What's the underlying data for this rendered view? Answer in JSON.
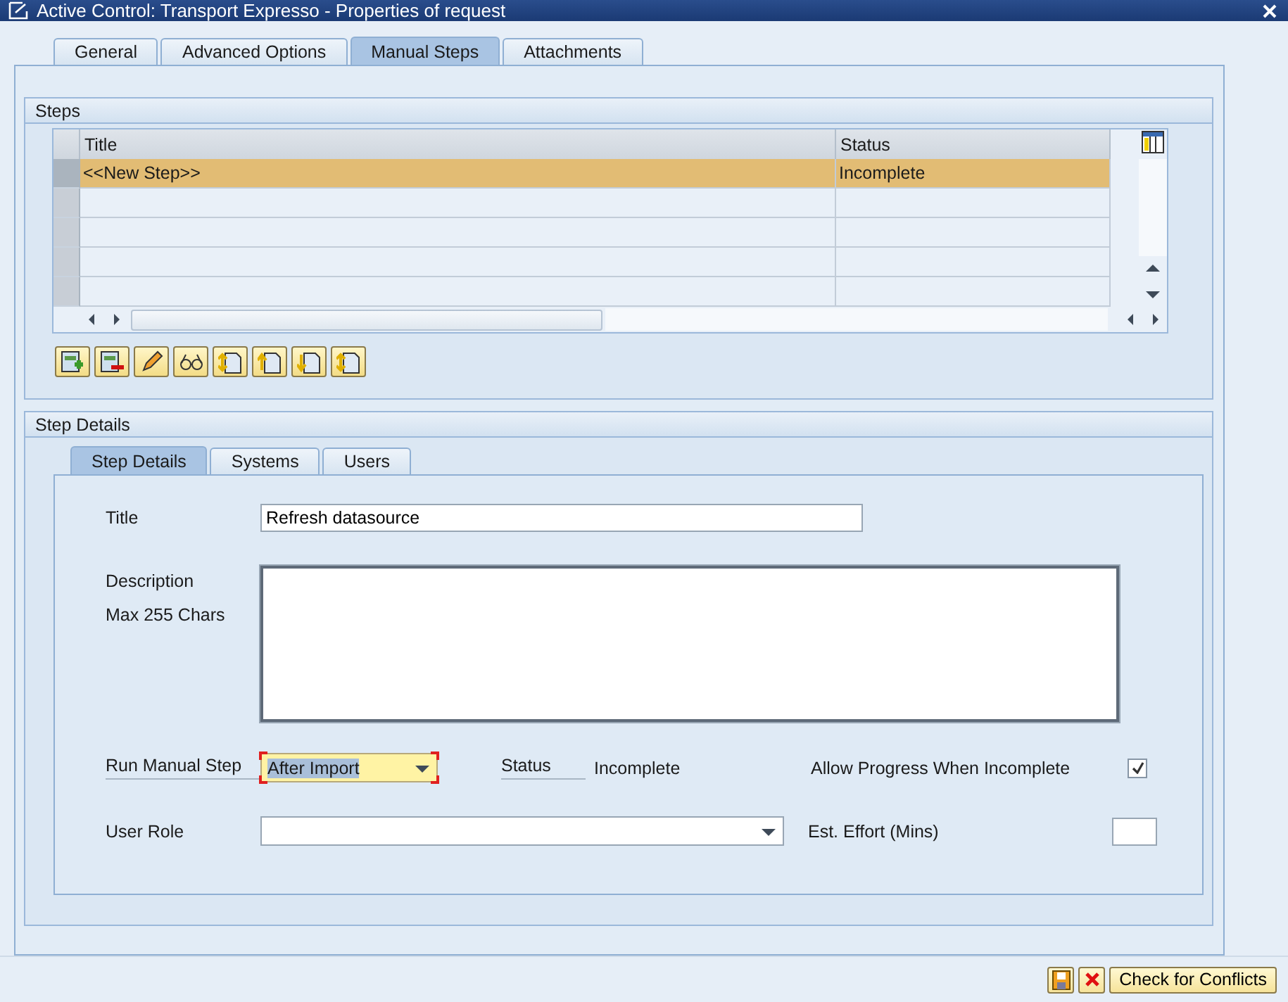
{
  "window": {
    "title": "Active Control: Transport Expresso - Properties of request"
  },
  "tabs": [
    {
      "label": "General",
      "selected": false
    },
    {
      "label": "Advanced Options",
      "selected": false
    },
    {
      "label": "Manual Steps",
      "selected": true
    },
    {
      "label": "Attachments",
      "selected": false
    }
  ],
  "steps": {
    "title": "Steps",
    "table": {
      "columns": [
        "Title",
        "Status"
      ],
      "rows": [
        {
          "title": "<<New Step>>",
          "status": "Incomplete",
          "selected": true
        }
      ]
    },
    "toolbar": [
      {
        "kind": "add"
      },
      {
        "kind": "delete"
      },
      {
        "kind": "edit"
      },
      {
        "kind": "display"
      },
      {
        "kind": "move-both"
      },
      {
        "kind": "move-up"
      },
      {
        "kind": "move-down"
      },
      {
        "kind": "move-both"
      }
    ]
  },
  "step_details": {
    "title": "Step Details",
    "tabs": [
      {
        "label": "Step Details",
        "selected": true
      },
      {
        "label": "Systems",
        "selected": false
      },
      {
        "label": "Users",
        "selected": false
      }
    ],
    "title_label": "Title",
    "title_value": "Refresh datasource",
    "description_label": "Description",
    "description_hint": "Max 255 Chars",
    "run_label": "Run Manual Step",
    "run_value": "After Import",
    "status_label": "Status",
    "status_value": "Incomplete",
    "allow_label": "Allow Progress When Incomplete",
    "allow_checked": true,
    "role_label": "User Role",
    "effort_label": "Est. Effort (Mins)"
  },
  "footer": {
    "buttons": [
      {
        "kind": "save"
      },
      {
        "kind": "cancel"
      },
      {
        "kind": "text",
        "label": "Check for Conflicts"
      }
    ]
  }
}
